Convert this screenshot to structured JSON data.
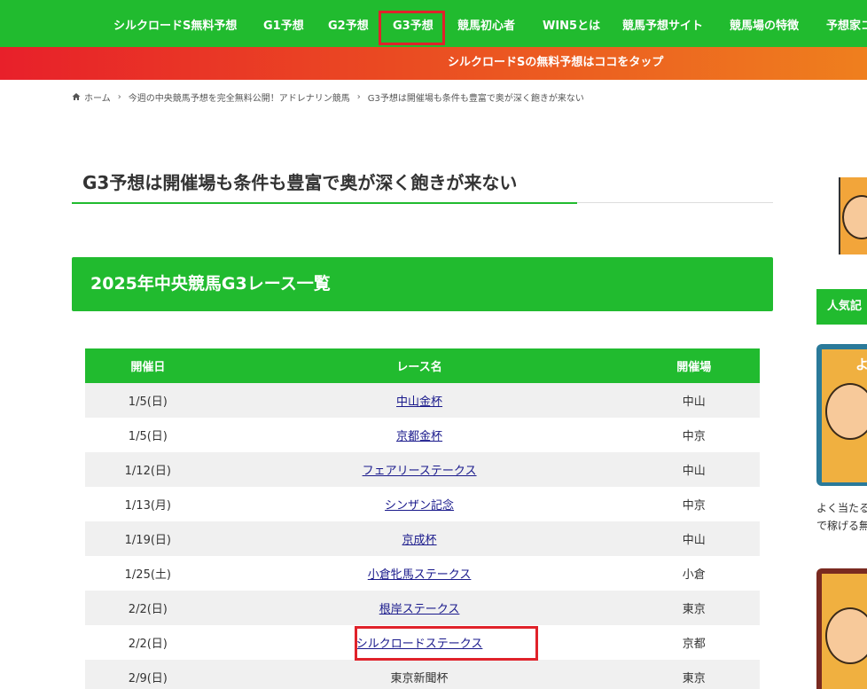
{
  "nav": {
    "items": [
      {
        "label": "シルクロードS無料予想"
      },
      {
        "label": "G1予想"
      },
      {
        "label": "G2予想"
      },
      {
        "label": "G3予想"
      },
      {
        "label": "競馬初心者"
      },
      {
        "label": "WIN5とは"
      },
      {
        "label": "競馬予想サイト"
      },
      {
        "label": "競馬場の特徴"
      },
      {
        "label": "予想家コ"
      }
    ]
  },
  "banner": {
    "text": "シルクロードSの無料予想はココをタップ"
  },
  "breadcrumb": {
    "home_icon": "home-icon",
    "items": [
      {
        "label": "ホーム"
      },
      {
        "label": "今週の中央競馬予想を完全無料公開！アドレナリン競馬"
      },
      {
        "label": "G3予想は開催場も条件も豊富で奥が深く飽きが来ない"
      }
    ]
  },
  "page": {
    "title": "G3予想は開催場も条件も豊富で奥が深く飽きが来ない"
  },
  "section": {
    "heading": "2025年中央競馬G3レース一覧"
  },
  "table": {
    "headers": {
      "date": "開催日",
      "name": "レース名",
      "venue": "開催場"
    },
    "rows": [
      {
        "date": "1/5(日)",
        "name": "中山金杯",
        "venue": "中山"
      },
      {
        "date": "1/5(日)",
        "name": "京都金杯",
        "venue": "中京"
      },
      {
        "date": "1/12(日)",
        "name": "フェアリーステークス",
        "venue": "中山"
      },
      {
        "date": "1/13(月)",
        "name": "シンザン記念",
        "venue": "中京"
      },
      {
        "date": "1/19(日)",
        "name": "京成杯",
        "venue": "中山"
      },
      {
        "date": "1/25(土)",
        "name": "小倉牝馬ステークス",
        "venue": "小倉"
      },
      {
        "date": "2/2(日)",
        "name": "根岸ステークス",
        "venue": "東京"
      },
      {
        "date": "2/2(日)",
        "name": "シルクロードステークス",
        "venue": "京都"
      },
      {
        "date": "2/9(日)",
        "name": "東京新聞杯",
        "venue": "東京"
      }
    ]
  },
  "sidebar": {
    "heading": "人気記",
    "card_letter": "よ",
    "card_text_line1": "よく当たる",
    "card_text_line2": "で稼げる無"
  },
  "colors": {
    "brand_green": "#21bb2f",
    "highlight_red": "#e0222a",
    "banner_start": "#e8202a",
    "banner_end": "#ef7f1e",
    "link": "#1a1a8c"
  }
}
